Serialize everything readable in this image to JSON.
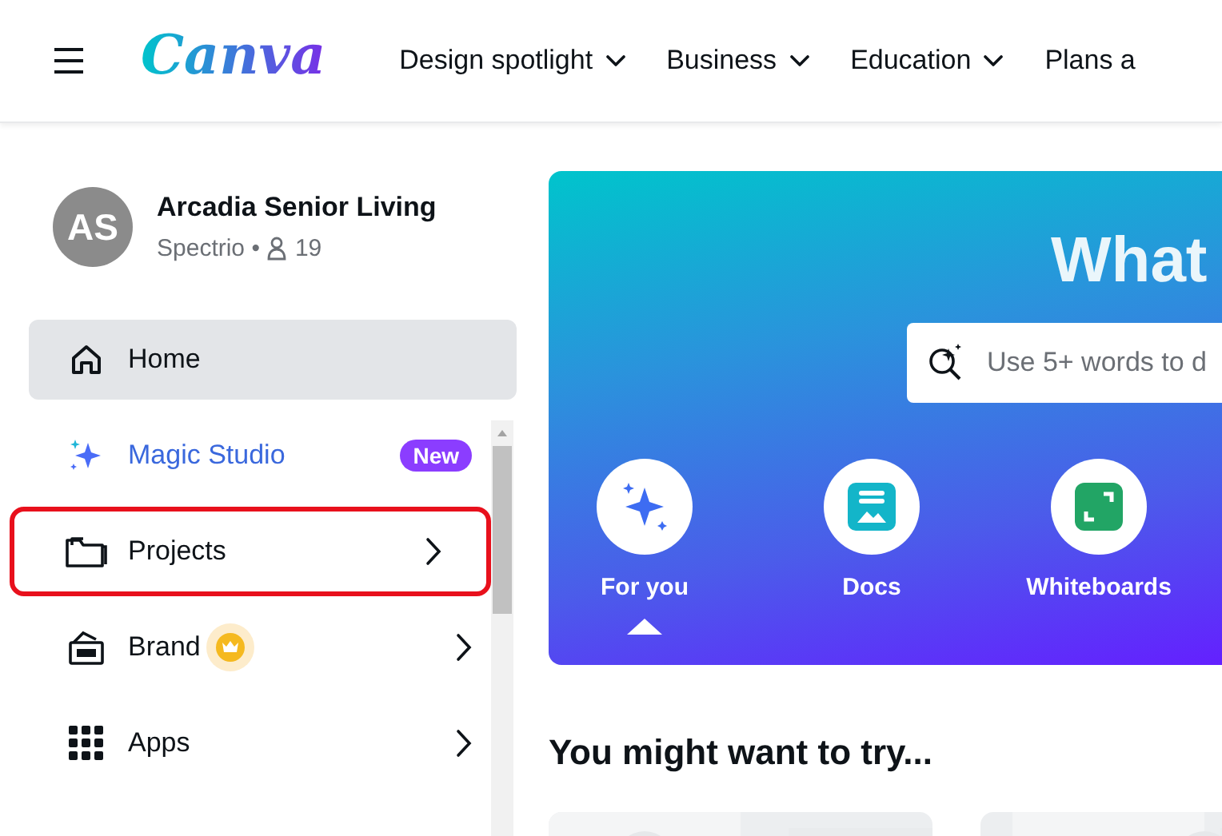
{
  "header": {
    "logo": "Canva",
    "nav": [
      {
        "label": "Design spotlight",
        "dropdown": true
      },
      {
        "label": "Business",
        "dropdown": true
      },
      {
        "label": "Education",
        "dropdown": true
      },
      {
        "label": "Plans a",
        "dropdown": false
      }
    ]
  },
  "sidebar": {
    "account": {
      "initials": "AS",
      "name": "Arcadia Senior Living",
      "team": "Spectrio",
      "separator": "•",
      "members": "19"
    },
    "items": [
      {
        "label": "Home",
        "selected": true,
        "accent": false,
        "highlighted": false,
        "expandable": false,
        "premium": false
      },
      {
        "label": "Magic Studio",
        "selected": false,
        "accent": true,
        "highlighted": false,
        "expandable": false,
        "premium": false,
        "badge": "New"
      },
      {
        "label": "Projects",
        "selected": false,
        "accent": false,
        "highlighted": true,
        "expandable": true,
        "premium": false
      },
      {
        "label": "Brand",
        "selected": false,
        "accent": false,
        "highlighted": false,
        "expandable": true,
        "premium": true
      },
      {
        "label": "Apps",
        "selected": false,
        "accent": false,
        "highlighted": false,
        "expandable": true,
        "premium": false
      }
    ]
  },
  "hero": {
    "title": "What",
    "search": {
      "placeholder": "Use 5+ words to d"
    },
    "tabs": [
      {
        "label": "For you",
        "selected": true
      },
      {
        "label": "Docs",
        "selected": false
      },
      {
        "label": "Whiteboards",
        "selected": false
      }
    ]
  },
  "suggestions": {
    "heading": "You might want to try..."
  }
}
